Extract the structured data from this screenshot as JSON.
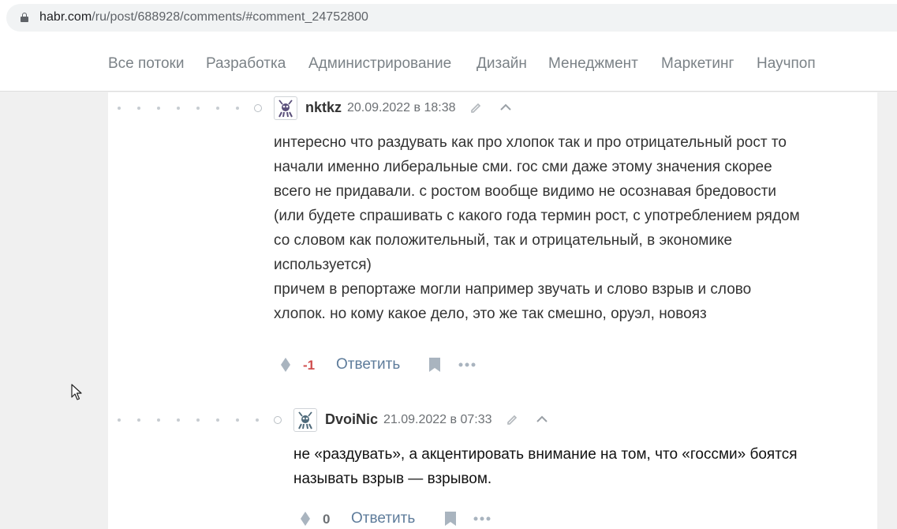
{
  "browser": {
    "url_host": "habr.com",
    "url_path": "/ru/post/688928/comments/#comment_24752800"
  },
  "nav": {
    "items": [
      {
        "label": "Все потоки"
      },
      {
        "label": "Разработка"
      },
      {
        "label": "Администрирование"
      },
      {
        "label": "Дизайн"
      },
      {
        "label": "Менеджмент"
      },
      {
        "label": "Маркетинг"
      },
      {
        "label": "Научпоп"
      }
    ]
  },
  "comments": [
    {
      "author": "nktkz",
      "date": "20.09.2022 в 18:38",
      "lines": [
        "интересно что раздувать как про хлопок так и про отрицательный рост то",
        "начали именно либеральные сми. гос сми даже этому значения скорее",
        "всего не придавали. с ростом вообще видимо не осознавая бредовости",
        "(или будете спрашивать с какого года термин рост, с употреблением рядом",
        "со словом как положительный, так и отрицательный, в экономике",
        "используется)",
        "причем в репортаже могли например звучать и слово взрыв и слово",
        "хлопок. но кому какое дело, это же так смешно, оруэл, новояз"
      ],
      "score": "-1",
      "reply_label": "Ответить"
    },
    {
      "author": "DvoiNic",
      "date": "21.09.2022 в 07:33",
      "lines": [
        "не «раздувать», а акцентировать внимание на том, что «госсми» боятся",
        "называть взрыв — взрывом."
      ],
      "score": "0",
      "reply_label": "Ответить"
    }
  ],
  "colors": {
    "accent": "#5e7c9b",
    "negative": "#d04e4e",
    "muted": "#7b8287"
  },
  "icons": [
    "lock-icon",
    "edit-icon",
    "chevron-up-icon",
    "vote-icon",
    "bookmark-icon",
    "more-icon",
    "mouse-cursor-icon"
  ]
}
